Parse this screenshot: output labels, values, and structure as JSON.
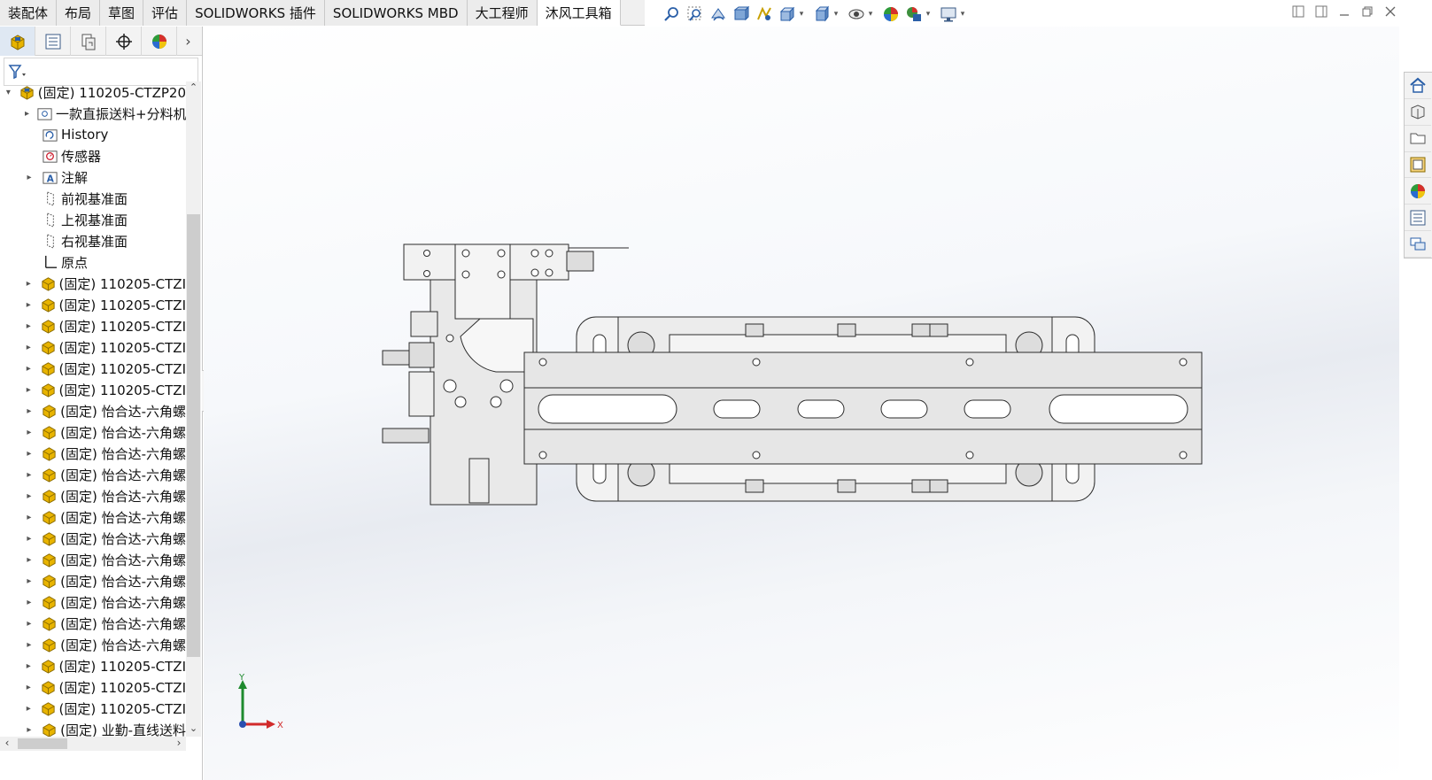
{
  "tabs": [
    "装配体",
    "布局",
    "草图",
    "评估",
    "SOLIDWORKS 插件",
    "SOLIDWORKS MBD",
    "大工程师",
    "沐风工具箱"
  ],
  "active_tab_index": 7,
  "view_toolbar_icons": [
    "zoom-to-fit-icon",
    "zoom-to-area-icon",
    "previous-view-icon",
    "section-view-icon",
    "dynamic-annotation-icon",
    "view-orientation-icon",
    "display-style-icon",
    "hide-show-icon",
    "edit-appearance-icon",
    "apply-scene-icon",
    "view-settings-icon"
  ],
  "window_controls": [
    "tile-left-icon",
    "tile-right-icon",
    "minimize-icon",
    "restore-icon",
    "close-icon"
  ],
  "panel_tabs": [
    "featuremanager-icon",
    "propertymanager-icon",
    "configurationmanager-icon",
    "dimxpert-icon",
    "displaymanager-icon"
  ],
  "tree": {
    "root": "(固定) 110205-CTZP20",
    "items": [
      {
        "label": "一款直振送料+分料机",
        "icon": "folder-icon",
        "expandable": true,
        "indent": 1
      },
      {
        "label": "History",
        "icon": "history-icon",
        "expandable": false,
        "indent": 1
      },
      {
        "label": "传感器",
        "icon": "sensor-icon",
        "expandable": false,
        "indent": 1
      },
      {
        "label": "注解",
        "icon": "annotation-icon",
        "expandable": true,
        "indent": 1
      },
      {
        "label": "前视基准面",
        "icon": "plane-icon",
        "expandable": false,
        "indent": 1
      },
      {
        "label": "上视基准面",
        "icon": "plane-icon",
        "expandable": false,
        "indent": 1
      },
      {
        "label": "右视基准面",
        "icon": "plane-icon",
        "expandable": false,
        "indent": 1
      },
      {
        "label": "原点",
        "icon": "origin-icon",
        "expandable": false,
        "indent": 1
      },
      {
        "label": "(固定) 110205-CTZI",
        "icon": "part-icon",
        "expandable": true,
        "indent": 1
      },
      {
        "label": "(固定) 110205-CTZI",
        "icon": "part-icon",
        "expandable": true,
        "indent": 1
      },
      {
        "label": "(固定) 110205-CTZI",
        "icon": "part-icon",
        "expandable": true,
        "indent": 1
      },
      {
        "label": "(固定) 110205-CTZI",
        "icon": "part-icon",
        "expandable": true,
        "indent": 1
      },
      {
        "label": "(固定) 110205-CTZI",
        "icon": "part-icon",
        "expandable": true,
        "indent": 1
      },
      {
        "label": "(固定) 110205-CTZI",
        "icon": "part-icon",
        "expandable": true,
        "indent": 1
      },
      {
        "label": "(固定) 怡合达-六角螺",
        "icon": "part-icon",
        "expandable": true,
        "indent": 1
      },
      {
        "label": "(固定) 怡合达-六角螺",
        "icon": "part-icon",
        "expandable": true,
        "indent": 1
      },
      {
        "label": "(固定) 怡合达-六角螺",
        "icon": "part-icon",
        "expandable": true,
        "indent": 1
      },
      {
        "label": "(固定) 怡合达-六角螺",
        "icon": "part-icon",
        "expandable": true,
        "indent": 1
      },
      {
        "label": "(固定) 怡合达-六角螺",
        "icon": "part-icon",
        "expandable": true,
        "indent": 1
      },
      {
        "label": "(固定) 怡合达-六角螺",
        "icon": "part-icon",
        "expandable": true,
        "indent": 1
      },
      {
        "label": "(固定) 怡合达-六角螺",
        "icon": "part-icon",
        "expandable": true,
        "indent": 1
      },
      {
        "label": "(固定) 怡合达-六角螺",
        "icon": "part-icon",
        "expandable": true,
        "indent": 1
      },
      {
        "label": "(固定) 怡合达-六角螺",
        "icon": "part-icon",
        "expandable": true,
        "indent": 1
      },
      {
        "label": "(固定) 怡合达-六角螺",
        "icon": "part-icon",
        "expandable": true,
        "indent": 1
      },
      {
        "label": "(固定) 怡合达-六角螺",
        "icon": "part-icon",
        "expandable": true,
        "indent": 1
      },
      {
        "label": "(固定) 怡合达-六角螺",
        "icon": "part-icon",
        "expandable": true,
        "indent": 1
      },
      {
        "label": "(固定) 110205-CTZI",
        "icon": "part-icon",
        "expandable": true,
        "indent": 1
      },
      {
        "label": "(固定) 110205-CTZI",
        "icon": "part-icon",
        "expandable": true,
        "indent": 1
      },
      {
        "label": "(固定) 110205-CTZI",
        "icon": "part-icon",
        "expandable": true,
        "indent": 1
      },
      {
        "label": "(固定) 业勤-直线送料",
        "icon": "part-icon",
        "expandable": true,
        "indent": 1
      }
    ]
  },
  "triad": {
    "y_label": "Y",
    "x_label": "X"
  },
  "task_pane_icons": [
    "home-icon",
    "design-library-icon",
    "file-explorer-icon",
    "view-palette-icon",
    "appearances-icon",
    "custom-properties-icon",
    "forum-icon"
  ],
  "colors": {
    "part_icon": "#e8b400",
    "accent": "#1a6fc7"
  }
}
